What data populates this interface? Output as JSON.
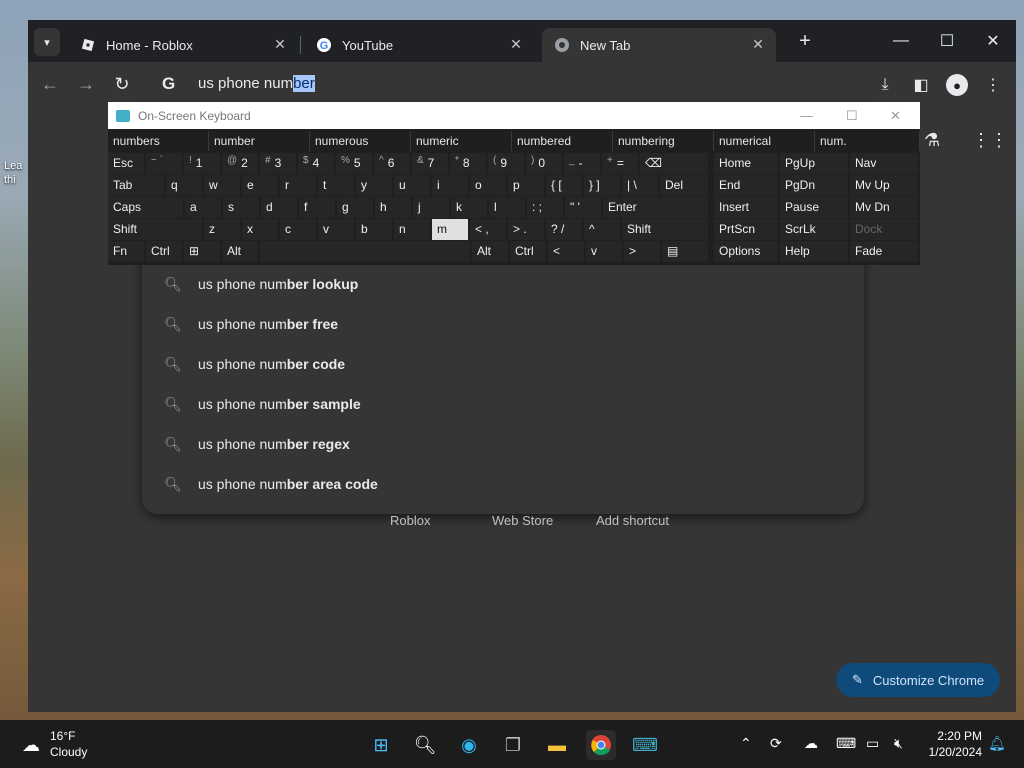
{
  "browser": {
    "tabs": [
      {
        "label": "Home - Roblox",
        "icon": "roblox-icon"
      },
      {
        "label": "YouTube",
        "icon": "google-icon"
      },
      {
        "label": "New Tab",
        "icon": "chrome-icon",
        "active": true
      }
    ],
    "new_tab": "+",
    "omnibox": {
      "typed": "us phone num",
      "selected": "ber",
      "g": "G"
    },
    "suggestions": [
      {
        "prefix": "us phone num",
        "bold": "ber lookup"
      },
      {
        "prefix": "us phone num",
        "bold": "ber free"
      },
      {
        "prefix": "us phone num",
        "bold": "ber code"
      },
      {
        "prefix": "us phone num",
        "bold": "ber sample"
      },
      {
        "prefix": "us phone num",
        "bold": "ber regex"
      },
      {
        "prefix": "us phone num",
        "bold": "ber area code"
      }
    ],
    "shortcuts": [
      "Roblox",
      "Web Store",
      "Add shortcut"
    ],
    "customize": "Customize Chrome"
  },
  "osk": {
    "title": "On-Screen Keyboard",
    "predictions": [
      "numbers",
      "number",
      "numerous",
      "numeric",
      "numbered",
      "numbering",
      "numerical",
      "num."
    ],
    "row1": [
      {
        "m": "Esc"
      },
      {
        "s": "~ `",
        "m": ""
      },
      {
        "s": "!",
        "m": "1"
      },
      {
        "s": "@",
        "m": "2"
      },
      {
        "s": "#",
        "m": "3"
      },
      {
        "s": "$",
        "m": "4"
      },
      {
        "s": "%",
        "m": "5"
      },
      {
        "s": "^",
        "m": "6"
      },
      {
        "s": "&",
        "m": "7"
      },
      {
        "s": "*",
        "m": "8"
      },
      {
        "s": "(",
        "m": "9"
      },
      {
        "s": ")",
        "m": "0"
      },
      {
        "s": "_",
        "m": "-"
      },
      {
        "s": "+",
        "m": "="
      },
      {
        "m": "⌫"
      }
    ],
    "row2": [
      "Tab",
      "q",
      "w",
      "e",
      "r",
      "t",
      "y",
      "u",
      "i",
      "o",
      "p",
      "{ [",
      "} ]",
      "| \\",
      "Del"
    ],
    "row3": [
      "Caps",
      "a",
      "s",
      "d",
      "f",
      "g",
      "h",
      "j",
      "k",
      "l",
      ": ;",
      "\" '",
      "Enter"
    ],
    "row4": [
      "Shift",
      "z",
      "x",
      "c",
      "v",
      "b",
      "n",
      "m",
      "< ,",
      "> .",
      "? /",
      "^",
      "Shift"
    ],
    "row5": [
      "Fn",
      "Ctrl",
      "⊞",
      "Alt",
      "",
      "Alt",
      "Ctrl",
      "<",
      "v",
      ">",
      "▤"
    ],
    "nav": [
      [
        "Home",
        "PgUp",
        "Nav"
      ],
      [
        "End",
        "PgDn",
        "Mv Up"
      ],
      [
        "Insert",
        "Pause",
        "Mv Dn"
      ],
      [
        "PrtScn",
        "ScrLk",
        "Dock"
      ],
      [
        "Options",
        "Help",
        "Fade"
      ]
    ]
  },
  "taskbar": {
    "weather_temp": "16°F",
    "weather_desc": "Cloudy",
    "time": "2:20 PM",
    "date": "1/20/2024"
  },
  "desktop": {
    "icon_label_1": "Lea",
    "icon_label_2": "thi"
  }
}
